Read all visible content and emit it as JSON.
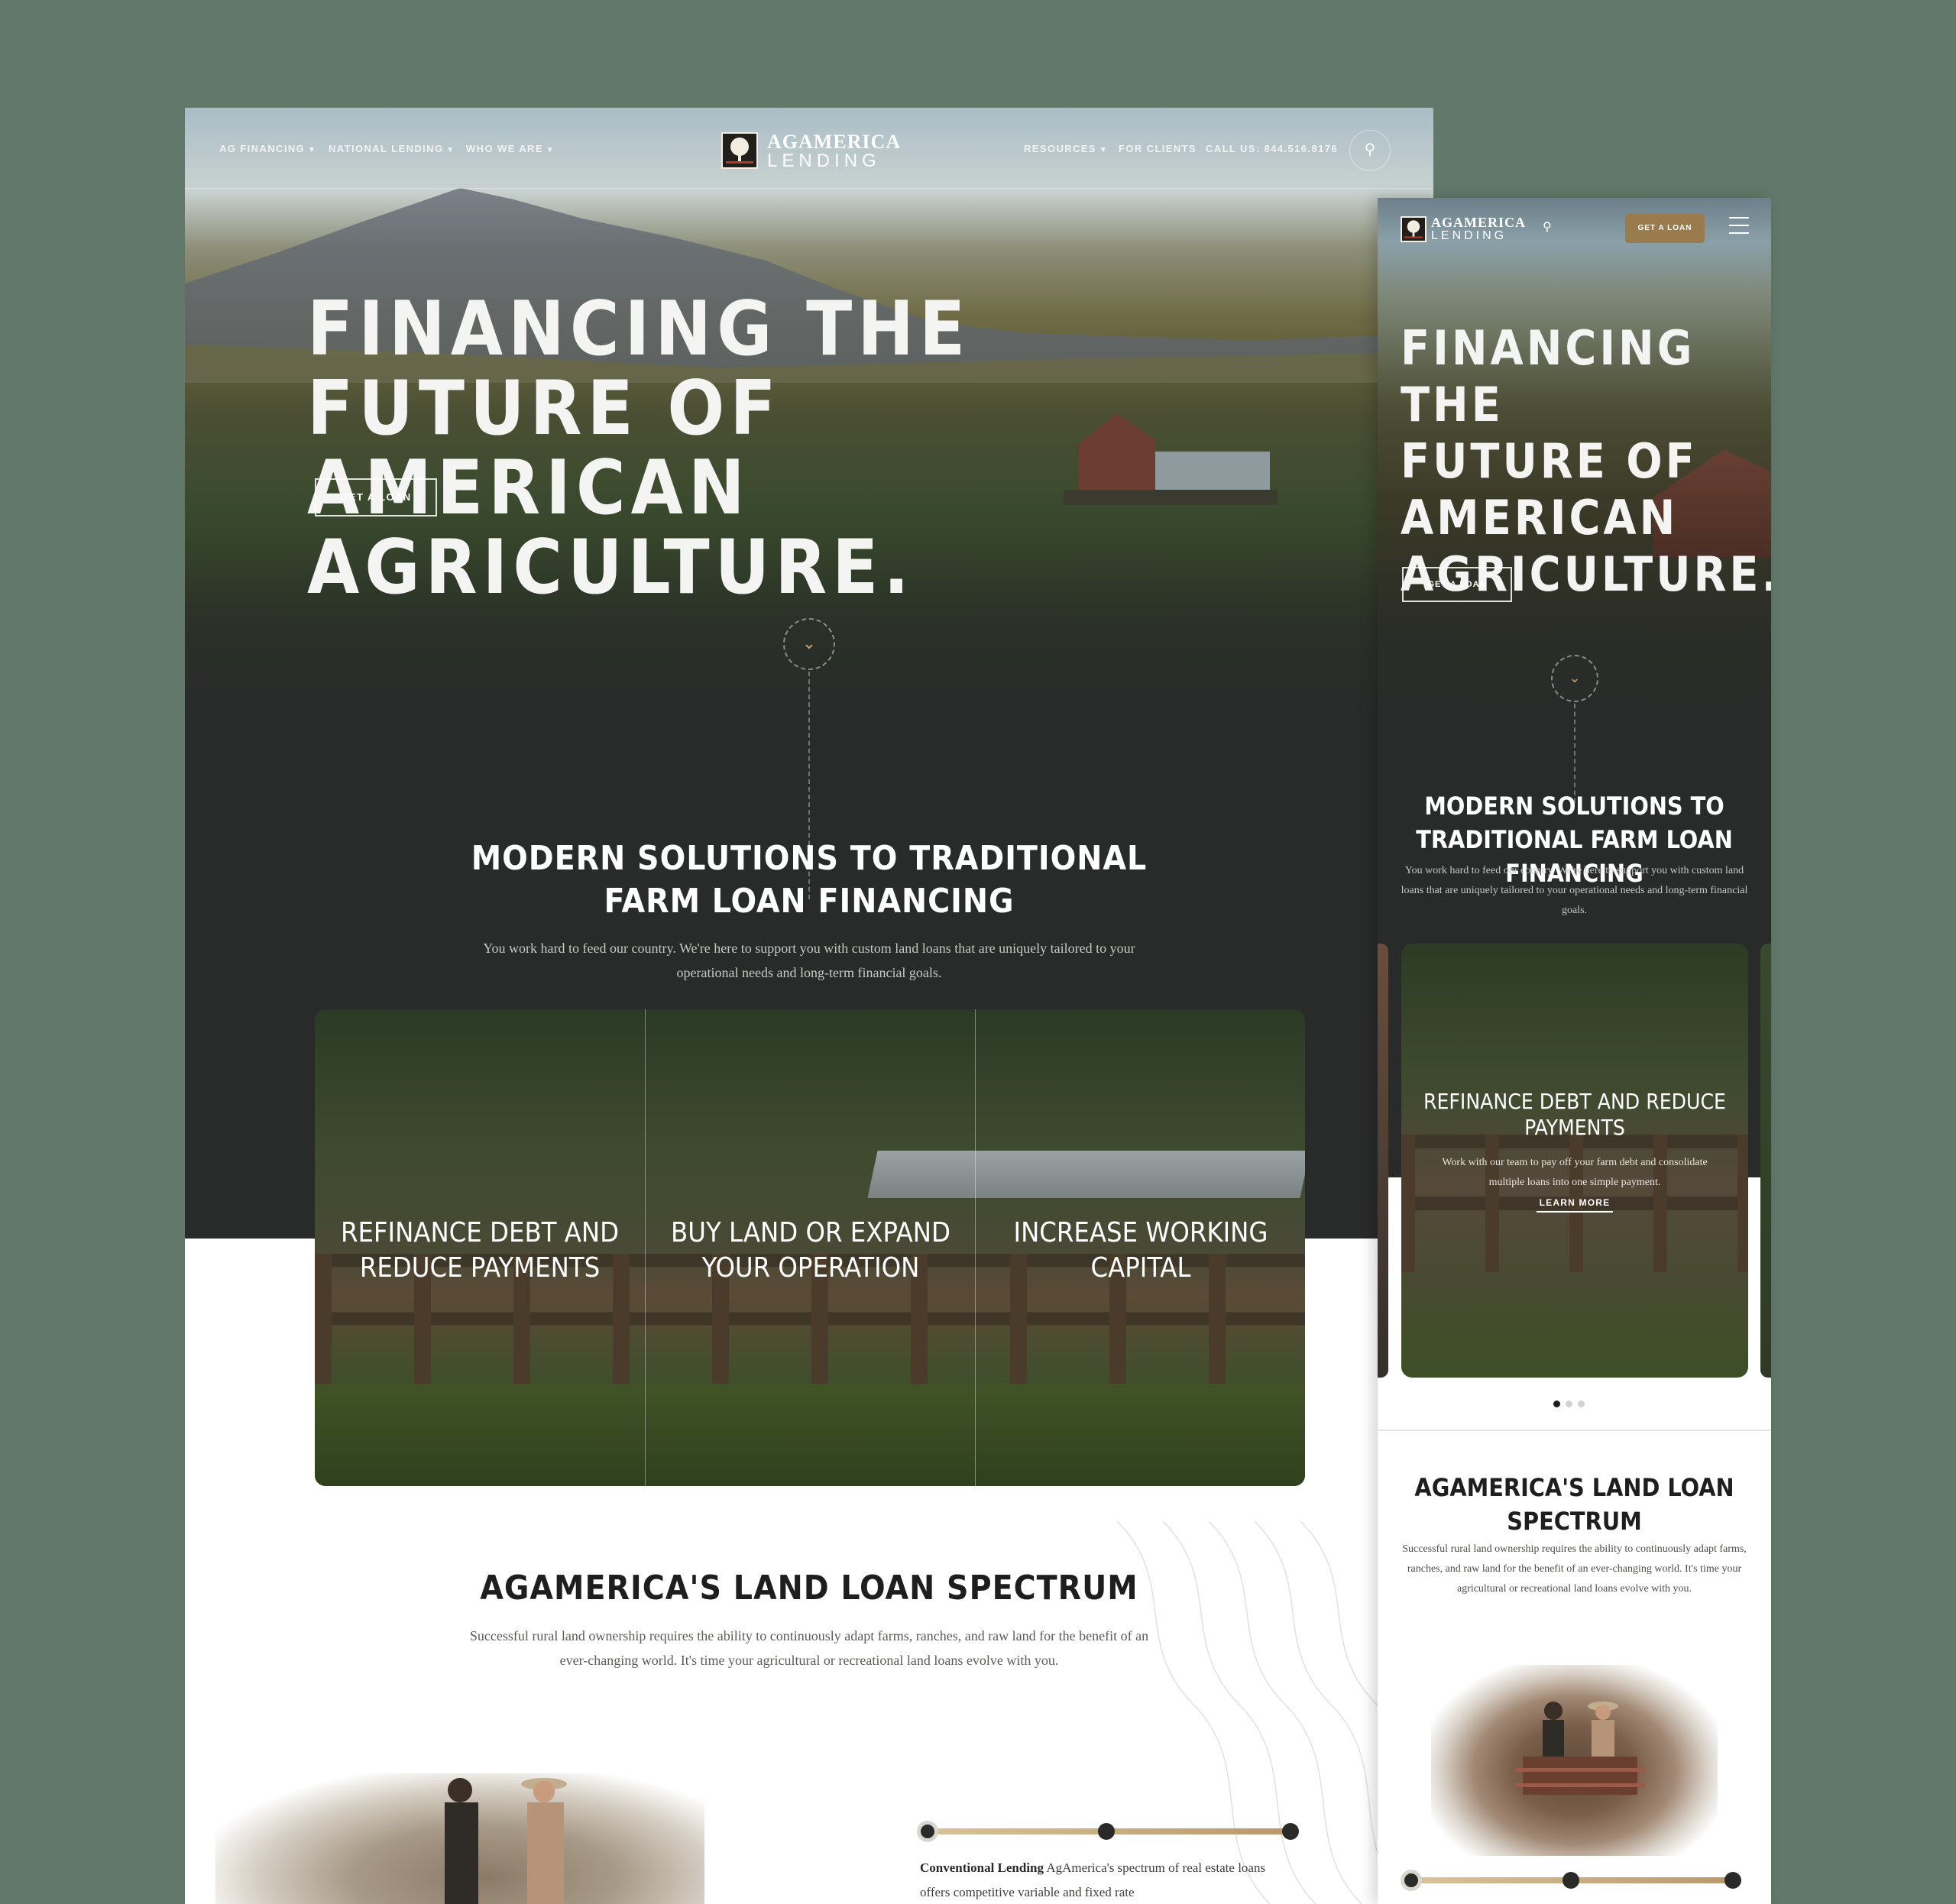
{
  "desktop": {
    "nav": {
      "left": [
        "AG FINANCING",
        "NATIONAL LENDING",
        "WHO WE ARE"
      ],
      "right": [
        "RESOURCES",
        "FOR CLIENTS",
        "CALL US: 844.516.8176"
      ]
    },
    "logo": {
      "top": "AGAMERICA",
      "bottom": "LENDING"
    },
    "hero": {
      "line1": "FINANCING THE FUTURE OF",
      "line2": "AMERICAN AGRICULTURE.",
      "cta": "GET A LOAN"
    },
    "section1": {
      "title": "MODERN SOLUTIONS TO TRADITIONAL FARM LOAN FINANCING",
      "body": "You work hard to feed our country. We're here to support you with custom land loans that are uniquely tailored to your operational needs and long-term financial goals."
    },
    "cards": [
      "REFINANCE DEBT AND REDUCE PAYMENTS",
      "BUY LAND OR EXPAND YOUR OPERATION",
      "INCREASE WORKING CAPITAL"
    ],
    "section2": {
      "title": "AGAMERICA'S LAND LOAN SPECTRUM",
      "body": "Successful rural land ownership requires the ability to continuously adapt farms, ranches, and raw land for the benefit of an ever-changing world. It's time your agricultural or recreational land loans evolve with you."
    },
    "conventional": {
      "bold": "Conventional Lending",
      "text": " AgAmerica's spectrum of real estate loans offers competitive variable and fixed rate"
    }
  },
  "mobile": {
    "logo": {
      "top": "AGAMERICA",
      "bottom": "LENDING"
    },
    "get_loan": "GET A LOAN",
    "hero": {
      "line1": "FINANCING THE",
      "line2": "FUTURE OF",
      "line3": "AMERICAN",
      "line4": "AGRICULTURE.",
      "cta": "GET A LOAN"
    },
    "section1": {
      "title": "MODERN SOLUTIONS TO TRADITIONAL FARM LOAN FINANCING",
      "body": "You work hard to feed our country. We're here to support you with custom land loans that are uniquely tailored to your operational needs and long-term financial goals."
    },
    "card": {
      "title": "REFINANCE DEBT AND REDUCE PAYMENTS",
      "body": "Work with our team to pay off your farm debt and consolidate multiple loans into one simple payment.",
      "link": "LEARN MORE"
    },
    "carousel": {
      "slides": 3,
      "active": 1
    },
    "section2": {
      "title": "AGAMERICA'S LAND LOAN SPECTRUM",
      "body": "Successful rural land ownership requires the ability to continuously adapt farms, ranches, and raw land for the benefit of an ever-changing world. It's time your agricultural or recreational land loans evolve with you."
    }
  },
  "icons": [
    "search-icon",
    "chevron-down-icon",
    "menu-icon",
    "logo-tree-icon"
  ],
  "colors": {
    "background": "#62786a",
    "dark": "#292b2a",
    "accent": "#9a7b4e",
    "gold": "#c9a871"
  }
}
